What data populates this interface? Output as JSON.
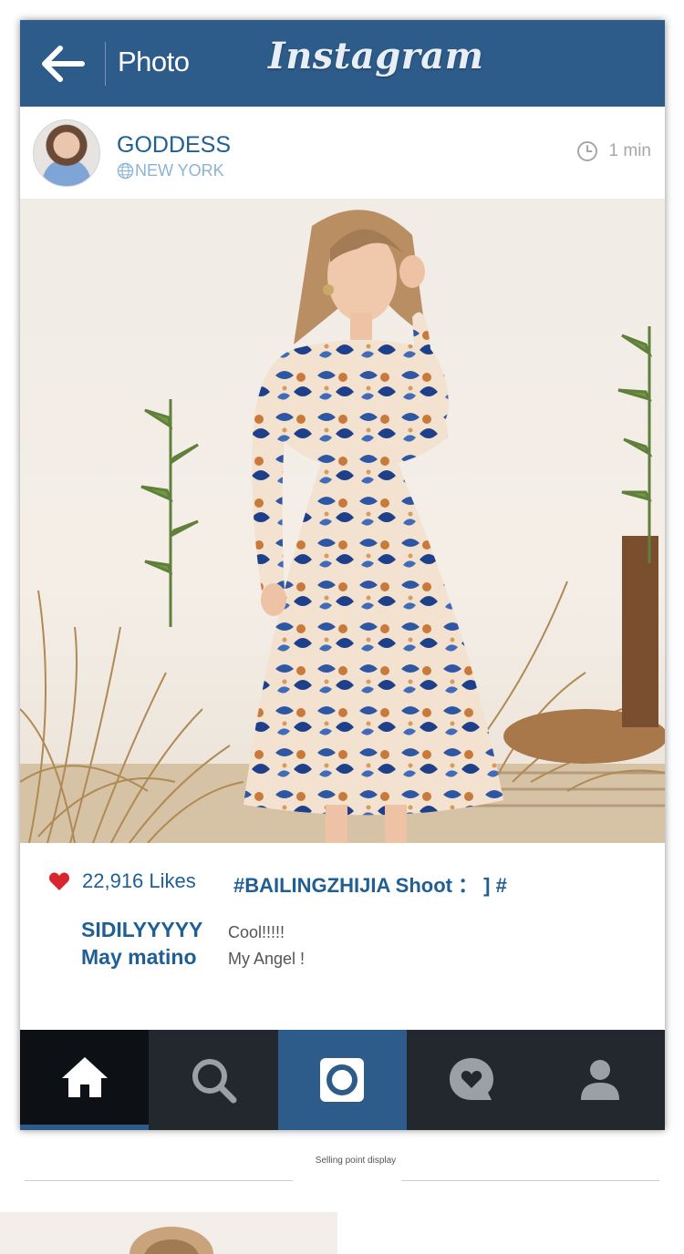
{
  "topbar": {
    "title": "Photo",
    "brand": "Instagram",
    "color": "#2d5b8a"
  },
  "post": {
    "username": "GODDESS",
    "location": "NEW YORK",
    "time": "1 min",
    "likes": "22,916 Likes",
    "hashtag": "#BAILINGZHIJIA Shoot ： ] #",
    "comments": [
      {
        "user": "SIDILYYYYY",
        "text": "Cool!!!!!"
      },
      {
        "user": "May matino",
        "text": "My Angel !"
      }
    ]
  },
  "nav": {
    "items": [
      "home-icon",
      "search-icon",
      "camera-icon",
      "activity-icon",
      "profile-icon"
    ],
    "active": "home"
  },
  "footer": {
    "caption": "Selling point display"
  },
  "colors": {
    "accent": "#1f5f93",
    "heart": "#d7262f",
    "nav_dark": "#23272e"
  }
}
